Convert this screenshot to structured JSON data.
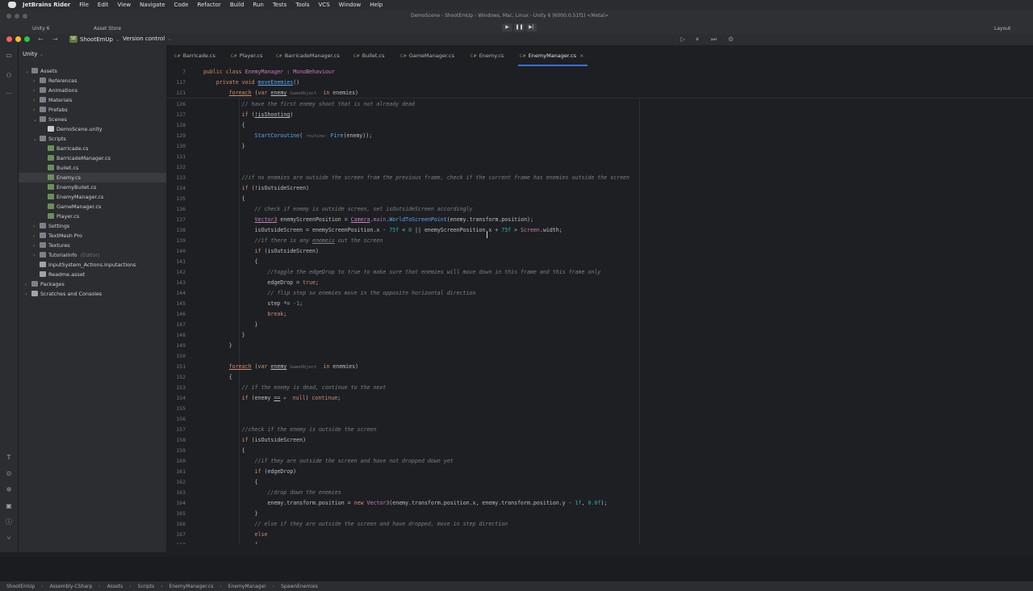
{
  "menubar": {
    "app": "JetBrains Rider",
    "items": [
      "File",
      "Edit",
      "View",
      "Navigate",
      "Code",
      "Refactor",
      "Build",
      "Run",
      "Tests",
      "Tools",
      "VCS",
      "Window",
      "Help"
    ]
  },
  "unity": {
    "title": "DemoScene - ShootEmUp - Windows, Mac, Linux - Unity 6 (6000.0.51f1) <Metal>",
    "account": "Unity 6",
    "store": "Asset Store",
    "layout": "Layout"
  },
  "toolbar": {
    "project": "ShootEmUp",
    "vcs": "Version control",
    "badge": "SE"
  },
  "project": {
    "title": "Unity",
    "tree": [
      {
        "label": "Assets",
        "indent": 0,
        "icon": "folder",
        "open": true
      },
      {
        "label": "References",
        "indent": 1,
        "icon": "folder",
        "open": false
      },
      {
        "label": "Animations",
        "indent": 1,
        "icon": "folder",
        "open": false
      },
      {
        "label": "Materials",
        "indent": 1,
        "icon": "folder",
        "open": false
      },
      {
        "label": "Prefabs",
        "indent": 1,
        "icon": "folder",
        "open": false
      },
      {
        "label": "Scenes",
        "indent": 1,
        "icon": "folder",
        "open": true
      },
      {
        "label": "DemoScene.unity",
        "indent": 2,
        "icon": "unity"
      },
      {
        "label": "Scripts",
        "indent": 1,
        "icon": "folder",
        "open": true
      },
      {
        "label": "Barricade.cs",
        "indent": 2,
        "icon": "cs"
      },
      {
        "label": "BarricadeManager.cs",
        "indent": 2,
        "icon": "cs"
      },
      {
        "label": "Bullet.cs",
        "indent": 2,
        "icon": "cs"
      },
      {
        "label": "Enemy.cs",
        "indent": 2,
        "icon": "cs",
        "selected": true
      },
      {
        "label": "EnemyBullet.cs",
        "indent": 2,
        "icon": "cs"
      },
      {
        "label": "EnemyManager.cs",
        "indent": 2,
        "icon": "cs"
      },
      {
        "label": "GameManager.cs",
        "indent": 2,
        "icon": "cs"
      },
      {
        "label": "Player.cs",
        "indent": 2,
        "icon": "cs"
      },
      {
        "label": "Settings",
        "indent": 1,
        "icon": "folder",
        "open": false
      },
      {
        "label": "TextMesh Pro",
        "indent": 1,
        "icon": "folder",
        "open": false
      },
      {
        "label": "Textures",
        "indent": 1,
        "icon": "folder",
        "open": false
      },
      {
        "label": "TutorialInfo",
        "indent": 1,
        "icon": "folder",
        "open": false,
        "suffix": "(Editor)"
      },
      {
        "label": "InputSystem_Actions.inputactions",
        "indent": 1,
        "icon": "file"
      },
      {
        "label": "Readme.asset",
        "indent": 1,
        "icon": "file"
      },
      {
        "label": "Packages",
        "indent": 0,
        "icon": "folder",
        "open": false
      },
      {
        "label": "Scratches and Consoles",
        "indent": 0,
        "icon": "file",
        "open": false
      }
    ]
  },
  "tabs": [
    "Barricade.cs",
    "Player.cs",
    "BarricadeManager.cs",
    "Bullet.cs",
    "GameManager.cs",
    "Enemy.cs",
    "EnemyManager.cs"
  ],
  "active_tab": "EnemyManager.cs",
  "sticky": [
    {
      "ln": "7",
      "html": "<span class=\"k\">public class</span> <span class=\"t\">EnemyManager</span> : <span class=\"t\">MonoBehaviour</span>"
    },
    {
      "ln": "117",
      "html": "    <span class=\"k\">private void</span> <span class=\"f u\">moveEnemies</span>()"
    },
    {
      "ln": "121",
      "html": "        <span class=\"k u\">foreach</span> (<span class=\"k\">var</span> <span class=\"u\">enemy</span> <span class=\"h\">GameObject</span>  <span class=\"k\">in</span> enemies)"
    }
  ],
  "lines": [
    {
      "ln": "126",
      "html": "            <span class=\"c\">// have the first enemy shoot that is not already dead</span>"
    },
    {
      "ln": "127",
      "html": "            <span class=\"k\">if</span> (<span class=\"u\">!isShooting</span>)"
    },
    {
      "ln": "128",
      "html": "            {"
    },
    {
      "ln": "129",
      "html": "                <span class=\"f\">StartCoroutine</span>( <span class=\"h\">routine:</span> <span class=\"f\">Fire</span>(enemy));"
    },
    {
      "ln": "130",
      "html": "            }"
    },
    {
      "ln": "131",
      "html": ""
    },
    {
      "ln": "132",
      "html": ""
    },
    {
      "ln": "133",
      "html": "            <span class=\"c\">//if no enemies are outside the screen from the previous frame, check if the current frame has enemies outside the screen</span>"
    },
    {
      "ln": "134",
      "html": "            <span class=\"k\">if</span> (!isOutsideScreen)"
    },
    {
      "ln": "135",
      "html": "            {"
    },
    {
      "ln": "136",
      "html": "                <span class=\"c\">// check if enemy is outside screen, set isOutsideScreen accordingly</span>"
    },
    {
      "ln": "137",
      "html": "                <span class=\"t u\">Vector3</span> enemyScreenPosition = <span class=\"t u\">Camera</span>.<span class=\"s\">main</span>.<span class=\"f\">WorldToScreenPoint</span>(enemy.transform.position);"
    },
    {
      "ln": "138",
      "html": "                isOutsideScreen = enemyScreenPosition.x - <span class=\"n\">75f</span> &lt; <span class=\"n\">0</span> || enemyScreenPosition.x + <span class=\"n\">75f</span> &gt; <span class=\"t\">Screen</span>.width;"
    },
    {
      "ln": "139",
      "html": "                <span class=\"c\">//if there is any <span class=\"u\">enemeis</span> out the screen</span>"
    },
    {
      "ln": "140",
      "html": "                <span class=\"k\">if</span> (isOutsideScreen)"
    },
    {
      "ln": "141",
      "html": "                {"
    },
    {
      "ln": "142",
      "html": "                    <span class=\"c\">//toggle the edgeDrop to true to make sure that enemies will move down in this frame and this frame only</span>"
    },
    {
      "ln": "143",
      "html": "                    edgeDrop = <span class=\"k\">true</span>;"
    },
    {
      "ln": "144",
      "html": "                    <span class=\"c\">// flip step so enemies move in the opposite horizontal direction</span>"
    },
    {
      "ln": "145",
      "html": "                    step *= <span class=\"n\">-1</span>;"
    },
    {
      "ln": "146",
      "html": "                    <span class=\"k\">break</span>;"
    },
    {
      "ln": "147",
      "html": "                }"
    },
    {
      "ln": "148",
      "html": "            }"
    },
    {
      "ln": "149",
      "html": "        }"
    },
    {
      "ln": "150",
      "html": ""
    },
    {
      "ln": "151",
      "html": "        <span class=\"k u\">foreach</span> (<span class=\"k\">var</span> <span class=\"u\">enemy</span> <span class=\"h\">GameObject</span>  <span class=\"k\">in</span> enemies)"
    },
    {
      "ln": "152",
      "html": "        {"
    },
    {
      "ln": "153",
      "html": "            <span class=\"c\">// if the enemy is dead, continue to the next</span>"
    },
    {
      "ln": "154",
      "html": "            <span class=\"k\">if</span> (enemy <span class=\"u\">==</span> <span class=\"h\">✖</span>  <span class=\"k\">null</span>) <span class=\"k\">continue</span>;"
    },
    {
      "ln": "155",
      "html": ""
    },
    {
      "ln": "156",
      "html": ""
    },
    {
      "ln": "157",
      "html": "            <span class=\"c\">//check if the enemy is outside the screen</span>"
    },
    {
      "ln": "158",
      "html": "            <span class=\"k\">if</span> (isOutsideScreen)"
    },
    {
      "ln": "159",
      "html": "            {"
    },
    {
      "ln": "160",
      "html": "                <span class=\"c\">//if they are outside the screen and have not dropped down yet</span>"
    },
    {
      "ln": "161",
      "html": "                <span class=\"k\">if</span> (edgeDrop)"
    },
    {
      "ln": "162",
      "html": "                {"
    },
    {
      "ln": "163",
      "html": "                    <span class=\"c\">//drop down the enemies</span>"
    },
    {
      "ln": "164",
      "html": "                    enemy.transform.position = <span class=\"k\">new</span> <span class=\"t\">Vector3</span>(enemy.transform.position.x, enemy.transform.position.y - <span class=\"n\">1f</span>, <span class=\"n\">0.0f</span>);"
    },
    {
      "ln": "165",
      "html": "                }"
    },
    {
      "ln": "166",
      "html": "                <span class=\"c\">// else if they are outside the screen and have dropped, move in step direction</span>"
    },
    {
      "ln": "167",
      "html": "                <span class=\"k\">else</span>"
    },
    {
      "ln": "168",
      "html": "                {"
    }
  ],
  "status": [
    "ShootEmUp",
    "Assembly-CSharp",
    "Assets",
    "Scripts",
    "EnemyManager.cs",
    "EnemyManager",
    "SpawnEnemies"
  ]
}
